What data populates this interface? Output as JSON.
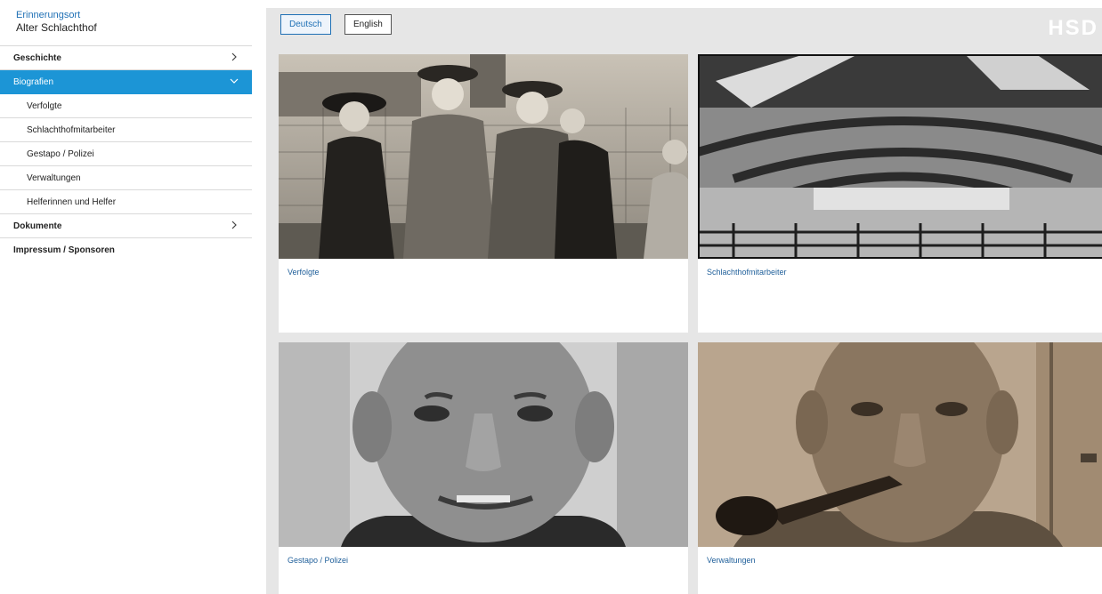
{
  "brand": {
    "line1": "Erinnerungsort",
    "line2": "Alter Schlachthof"
  },
  "nav": {
    "geschichte": "Geschichte",
    "biografien": "Biografien",
    "sub": [
      "Verfolgte",
      "Schlachthofmitarbeiter",
      "Gestapo / Polizei",
      "Verwaltungen",
      "Helferinnen und Helfer"
    ],
    "dokumente": "Dokumente",
    "impressum": "Impressum / Sponsoren"
  },
  "lang": {
    "de": "Deutsch",
    "en": "English",
    "selected": "Deutsch"
  },
  "logo": "HSD",
  "colors": {
    "accent": "#1c95d6",
    "link": "#1f5f9a",
    "background": "#e6e6e6"
  },
  "cards": [
    {
      "caption": "Verfolgte",
      "image": "group-photo-sepia"
    },
    {
      "caption": "Schlachthofmitarbeiter",
      "image": "slaughterhouse-hall-bw"
    },
    {
      "caption": "Gestapo / Polizei",
      "image": "portrait-man-bw"
    },
    {
      "caption": "Verwaltungen",
      "image": "portrait-man-pipe-sepia"
    }
  ]
}
